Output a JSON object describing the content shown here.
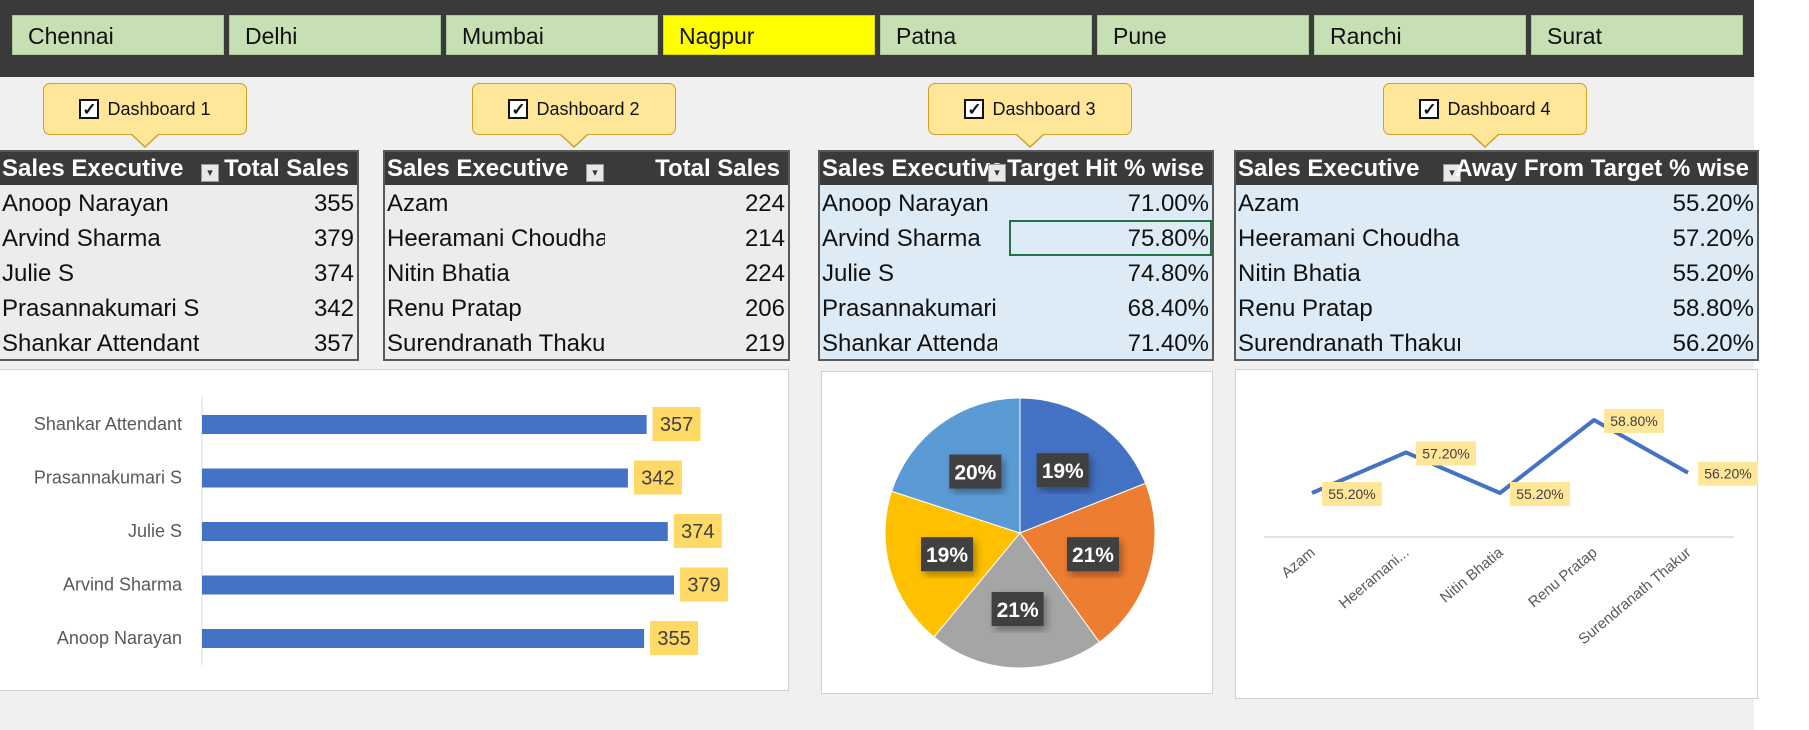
{
  "cities": [
    {
      "label": "Chennai"
    },
    {
      "label": "Delhi"
    },
    {
      "label": "Mumbai"
    },
    {
      "label": "Nagpur",
      "active": true
    },
    {
      "label": "Patna"
    },
    {
      "label": "Pune"
    },
    {
      "label": "Ranchi"
    },
    {
      "label": "Surat"
    }
  ],
  "dashboards": [
    {
      "label": "Dashboard 1",
      "checked": true
    },
    {
      "label": "Dashboard 2",
      "checked": true
    },
    {
      "label": "Dashboard 3",
      "checked": true
    },
    {
      "label": "Dashboard 4",
      "checked": true
    }
  ],
  "tables": [
    {
      "col1": "Sales Executive",
      "col2": "Total Sales",
      "rows": [
        {
          "name": "Anoop Narayan",
          "value": "355"
        },
        {
          "name": "Arvind Sharma",
          "value": "379"
        },
        {
          "name": "Julie S",
          "value": "374"
        },
        {
          "name": "Prasannakumari S",
          "value": "342"
        },
        {
          "name": "Shankar Attendant",
          "value": "357"
        }
      ]
    },
    {
      "col1": "Sales Executive",
      "col2": "Total Sales",
      "rows": [
        {
          "name": "Azam",
          "value": "224"
        },
        {
          "name": "Heeramani Choudhary",
          "value": "214"
        },
        {
          "name": "Nitin Bhatia",
          "value": "224"
        },
        {
          "name": "Renu Pratap",
          "value": "206"
        },
        {
          "name": "Surendranath Thakur",
          "value": "219"
        }
      ]
    },
    {
      "col1": "Sales Executive",
      "col2": "Target Hit % wise",
      "rows": [
        {
          "name": "Anoop Narayan",
          "value": "71.00%"
        },
        {
          "name": "Arvind Sharma",
          "value": "75.80%"
        },
        {
          "name": "Julie S",
          "value": "74.80%"
        },
        {
          "name": "Prasannakumari S",
          "value": "68.40%"
        },
        {
          "name": "Shankar Attendant",
          "value": "71.40%"
        }
      ]
    },
    {
      "col1": "Sales Executive",
      "col2": "Away From Target % wise",
      "rows": [
        {
          "name": "Azam",
          "value": "55.20%"
        },
        {
          "name": "Heeramani Choudhary",
          "value": "57.20%"
        },
        {
          "name": "Nitin Bhatia",
          "value": "55.20%"
        },
        {
          "name": "Renu Pratap",
          "value": "58.80%"
        },
        {
          "name": "Surendranath Thakur",
          "value": "56.20%"
        }
      ]
    }
  ],
  "icons": {
    "checkbox": "checkbox-checked-icon",
    "filter": "filter-dropdown-icon"
  },
  "colors": {
    "active_city": "#ffff00",
    "city": "#c6e0b4",
    "bar": "#4472c4",
    "label_bg": "#ffd966",
    "line": "#4472c4"
  },
  "chart_data": [
    {
      "type": "bar",
      "orientation": "horizontal",
      "categories": [
        "Shankar Attendant",
        "Prasannakumari S",
        "Julie S",
        "Arvind Sharma",
        "Anoop Narayan"
      ],
      "values": [
        357,
        342,
        374,
        379,
        355
      ],
      "data_labels": [
        "357",
        "342",
        "374",
        "379",
        "355"
      ],
      "color": "#4472c4"
    },
    {
      "type": "pie",
      "slices": [
        {
          "label": "19%",
          "value": 19,
          "color": "#4472c4"
        },
        {
          "label": "21%",
          "value": 21,
          "color": "#ed7d31"
        },
        {
          "label": "21%",
          "value": 21,
          "color": "#a5a5a5"
        },
        {
          "label": "19%",
          "value": 19,
          "color": "#ffc000"
        },
        {
          "label": "20%",
          "value": 20,
          "color": "#5b9bd5"
        }
      ]
    },
    {
      "type": "line",
      "categories": [
        "Azam",
        "Heeramani...",
        "Nitin Bhatia",
        "Renu Pratap",
        "Surendranath Thakur"
      ],
      "values": [
        55.2,
        57.2,
        55.2,
        58.8,
        56.2
      ],
      "data_labels": [
        "55.20%",
        "57.20%",
        "55.20%",
        "58.80%",
        "56.20%"
      ],
      "color": "#4472c4"
    }
  ]
}
